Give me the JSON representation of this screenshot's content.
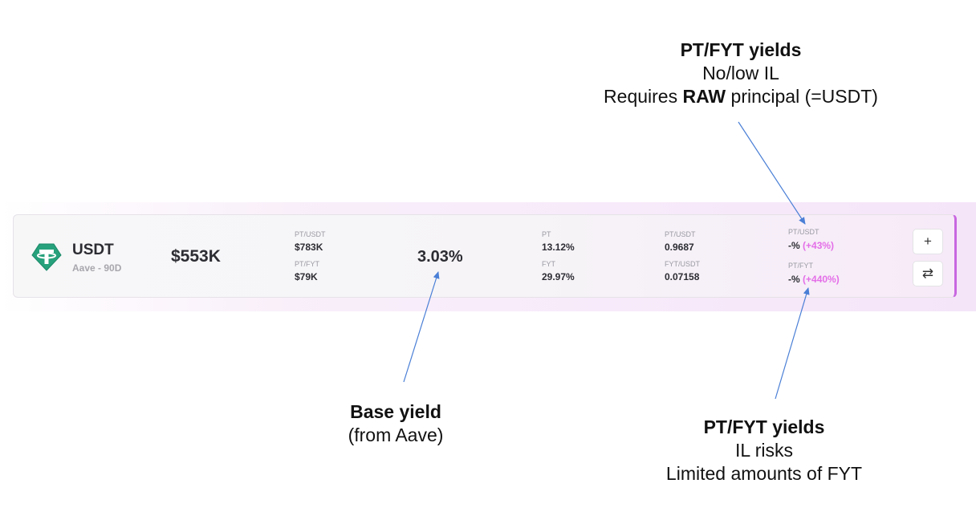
{
  "annotations": {
    "top": {
      "title": "PT/FYT yields",
      "line1": "No/low IL",
      "line2_prefix": "Requires ",
      "line2_bold": "RAW",
      "line2_suffix": " principal (=USDT)"
    },
    "base": {
      "title": "Base yield",
      "line1": "(from Aave)"
    },
    "bottom": {
      "title": "PT/FYT yields",
      "line1": "IL risks",
      "line2": "Limited amounts of FYT"
    }
  },
  "pool": {
    "token": "USDT",
    "platform": "Aave - 90D",
    "tvl": "$553K",
    "liquidity": {
      "pt_label": "PT/USDT",
      "pt_value": "$783K",
      "fyt_label": "PT/FYT",
      "fyt_value": "$79K"
    },
    "base_yield": "3.03%",
    "apy": {
      "pt_label": "PT",
      "pt_value": "13.12%",
      "fyt_label": "FYT",
      "fyt_value": "29.97%"
    },
    "prices": {
      "pt_label": "PT/USDT",
      "pt_value": "0.9687",
      "fyt_label": "FYT/USDT",
      "fyt_value": "0.07158"
    },
    "pool_yields": {
      "pt_label": "PT/USDT",
      "pt_value": "-%",
      "pt_boost": "(+43%)",
      "fyt_label": "PT/FYT",
      "fyt_value": "-%",
      "fyt_boost": "(+440%)"
    },
    "buttons": {
      "add": "+",
      "swap": "⇄"
    }
  },
  "colors": {
    "accent": "#e46ee8",
    "border_accent": "#c867e0",
    "tether_green": "#26a17b",
    "arrow": "#4a7fd6"
  },
  "icons": {
    "token": "tether-icon",
    "add": "plus-icon",
    "swap": "swap-icon"
  }
}
